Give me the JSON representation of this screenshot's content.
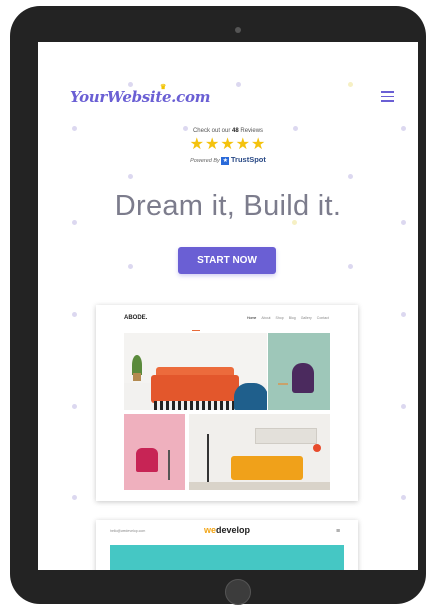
{
  "header": {
    "logo_text": "YourWebsite.com",
    "crown_glyph": "♛"
  },
  "reviews": {
    "prefix": "Check out our ",
    "count": "48",
    "suffix": " Reviews",
    "stars": "★★★★★",
    "powered_by": "Powered By",
    "provider": "TrustSpot",
    "provider_mark": "★"
  },
  "hero": {
    "headline": "Dream it, Build it.",
    "cta_label": "START NOW"
  },
  "preview_abode": {
    "logo": "ABODE.",
    "nav": [
      "Home",
      "About",
      "Shop",
      "Blog",
      "Gallery",
      "Contact"
    ]
  },
  "preview_wedevelop": {
    "email": "hello@wedevelop.com",
    "logo_prefix": "we",
    "logo_suffix": "develop",
    "menu_glyph": "≡"
  },
  "colors": {
    "accent": "#6a5fd4",
    "star": "#f4c20d",
    "banner": "#45c7c4"
  },
  "icons": {
    "menu": "hamburger-menu-icon",
    "trustspot": "trustspot-logo-icon"
  }
}
